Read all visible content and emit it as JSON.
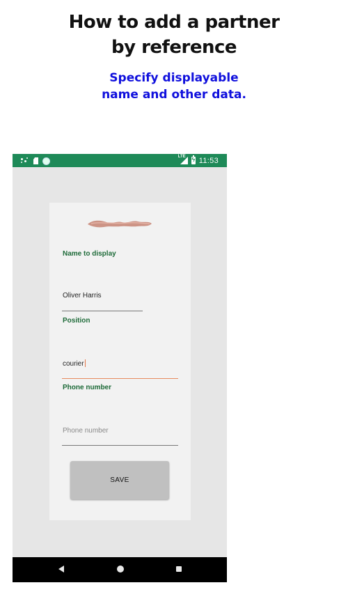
{
  "tutorial": {
    "title_line1": "How to add a partner",
    "title_line2": "by reference",
    "subtitle_line1": "Specify displayable",
    "subtitle_line2": "name and other data."
  },
  "status_bar": {
    "time": "11:53",
    "network": "LTE",
    "background_color": "#1e8a58"
  },
  "form": {
    "name_label": "Name to display",
    "name_value": "Oliver Harris",
    "position_label": "Position",
    "position_value": "courier",
    "phone_label": "Phone number",
    "phone_placeholder": "Phone number",
    "save_label": "SAVE",
    "label_color": "#1d6a38",
    "active_underline_color": "#e68a5e"
  },
  "nav_bar": {
    "back_icon": "back-triangle-icon",
    "home_icon": "home-circle-icon",
    "recent_icon": "recent-apps-square-icon"
  }
}
